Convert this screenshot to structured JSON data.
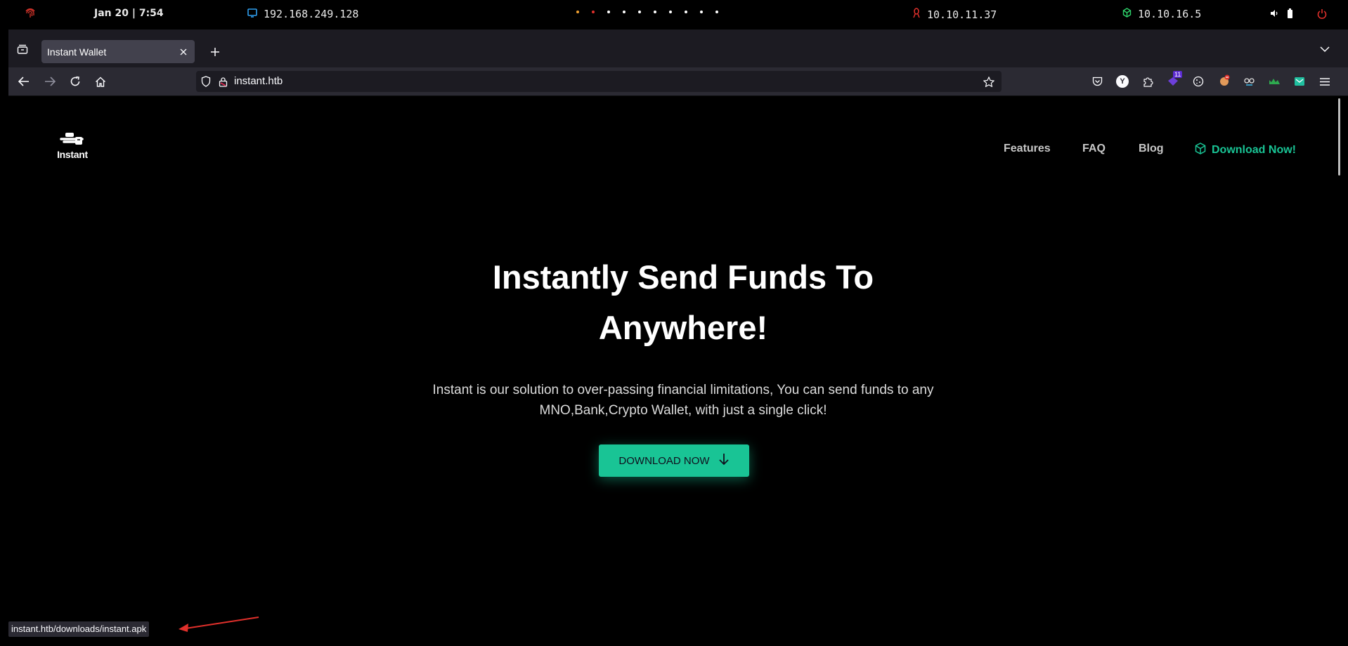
{
  "system_bar": {
    "datetime": "Jan 20  |  7:54",
    "vm_ip": "192.168.249.128",
    "target_ip": "10.10.11.37",
    "vpn_ip": "10.10.16.5"
  },
  "browser": {
    "tab_title": "Instant Wallet",
    "url": "instant.htb",
    "extension_badge_count": "11"
  },
  "site": {
    "logo_text": "Instant",
    "nav": {
      "features": "Features",
      "faq": "FAQ",
      "blog": "Blog",
      "download": "Download Now!"
    },
    "hero": {
      "title": "Instantly Send Funds To Anywhere!",
      "description": "Instant is our solution to over-passing financial limitations, You can send funds to any MNO,Bank,Crypto Wallet, with just a single click!",
      "cta_label": "DOWNLOAD NOW"
    },
    "accent_color": "#19c495"
  },
  "status_bar": {
    "hover_url": "instant.htb/downloads/instant.apk"
  },
  "icons": [
    "fingerprint-icon",
    "monitor-icon",
    "linux-icon",
    "cube-icon",
    "speaker-icon",
    "battery-icon",
    "power-icon",
    "tab-list-icon",
    "close-icon",
    "plus-icon",
    "chevron-down-icon",
    "back-icon",
    "forward-icon",
    "reload-icon",
    "home-icon",
    "shield-icon",
    "lock-icon",
    "star-icon",
    "pocket-icon",
    "menu-icon",
    "arrow-down-icon",
    "annotation-arrow"
  ]
}
